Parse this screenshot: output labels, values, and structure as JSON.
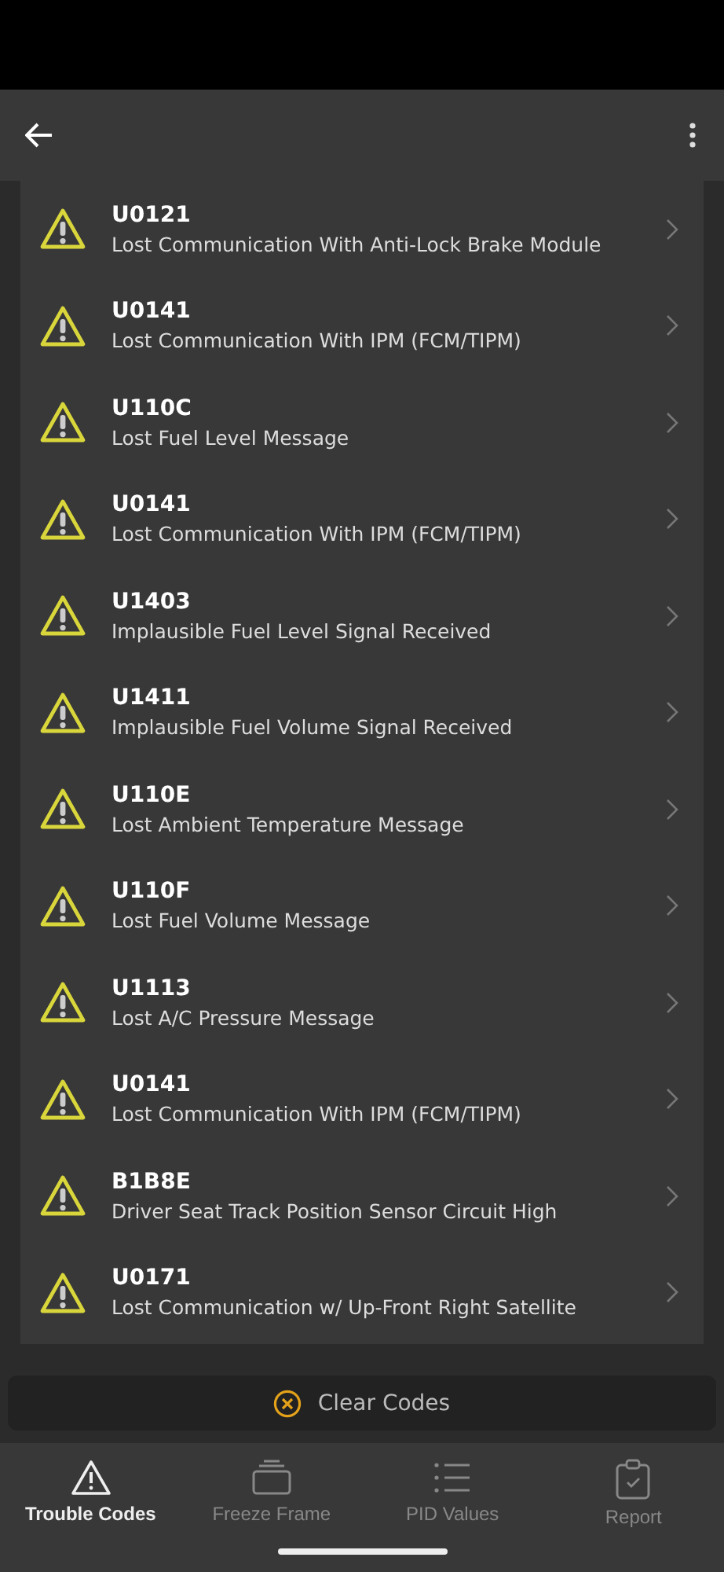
{
  "codes": [
    {
      "code": "U0121",
      "description": "Lost Communication With Anti-Lock Brake Module"
    },
    {
      "code": "U0141",
      "description": "Lost Communication With IPM (FCM/TIPM)"
    },
    {
      "code": "U110C",
      "description": "Lost Fuel Level Message"
    },
    {
      "code": "U0141",
      "description": "Lost Communication With IPM (FCM/TIPM)"
    },
    {
      "code": "U1403",
      "description": "Implausible Fuel Level Signal Received"
    },
    {
      "code": "U1411",
      "description": "Implausible Fuel Volume Signal Received"
    },
    {
      "code": "U110E",
      "description": "Lost Ambient Temperature Message"
    },
    {
      "code": "U110F",
      "description": "Lost Fuel Volume Message"
    },
    {
      "code": "U1113",
      "description": "Lost A/C Pressure Message"
    },
    {
      "code": "U0141",
      "description": "Lost Communication With IPM (FCM/TIPM)"
    },
    {
      "code": "B1B8E",
      "description": "Driver Seat Track Position Sensor Circuit High"
    },
    {
      "code": "U0171",
      "description": "Lost Communication w/ Up-Front Right Satellite"
    }
  ],
  "clear_button": "Clear Codes",
  "tabs": [
    {
      "kind": "warning",
      "label": "Trouble Codes",
      "selected": true
    },
    {
      "kind": "frame",
      "label": "Freeze Frame",
      "selected": false
    },
    {
      "kind": "list",
      "label": "PID Values",
      "selected": false
    },
    {
      "kind": "report",
      "label": "Report",
      "selected": false
    }
  ]
}
